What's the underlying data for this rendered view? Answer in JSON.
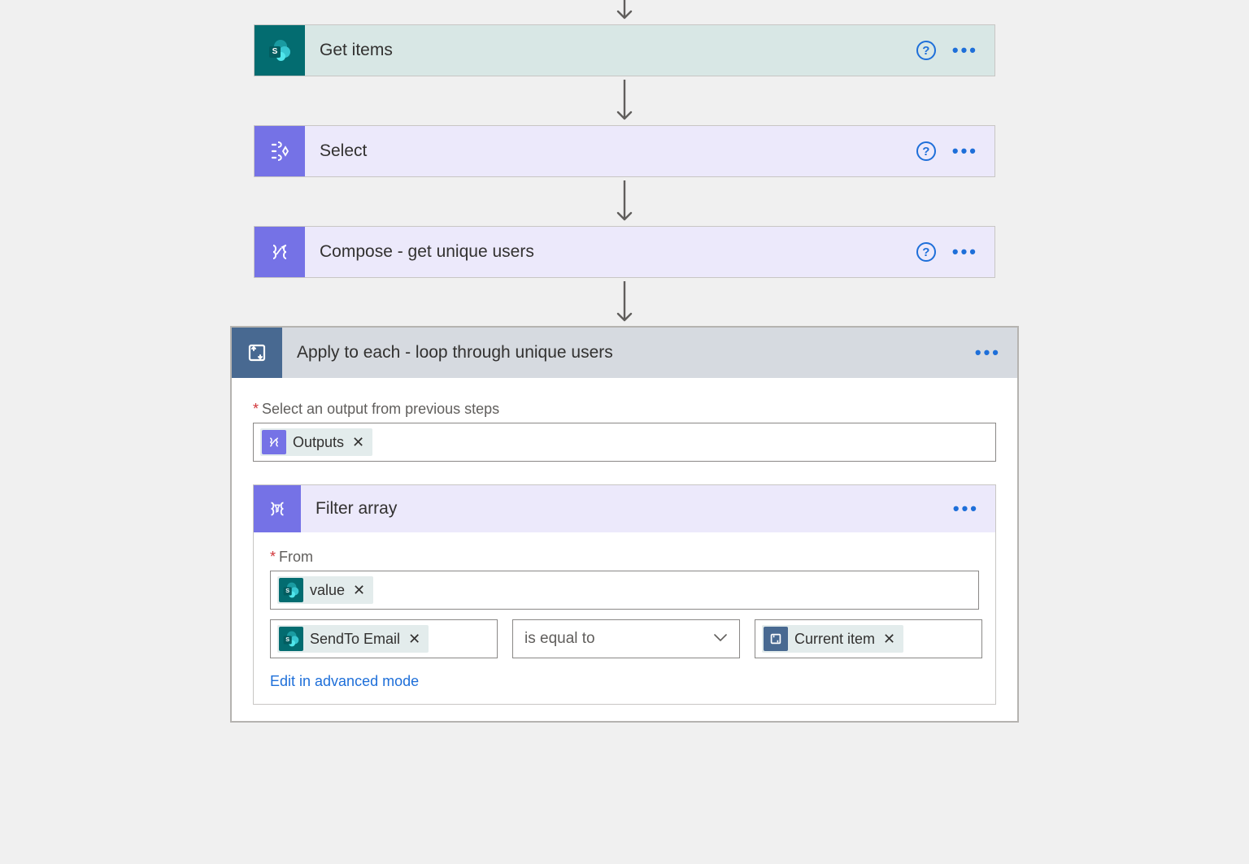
{
  "steps": {
    "get_items": {
      "title": "Get items"
    },
    "select": {
      "title": "Select"
    },
    "compose": {
      "title": "Compose - get unique users"
    },
    "apply": {
      "title": "Apply to each - loop through unique users"
    }
  },
  "apply_body": {
    "output_label": "Select an output from previous steps",
    "output_token": "Outputs"
  },
  "filter": {
    "title": "Filter array",
    "from_label": "From",
    "from_token": "value",
    "left_token": "SendTo Email",
    "operator": "is equal to",
    "right_token": "Current item",
    "advanced_link": "Edit in advanced mode"
  },
  "glyphs": {
    "help": "?",
    "dots": "•••",
    "close": "✕",
    "sp_letter": "S"
  }
}
